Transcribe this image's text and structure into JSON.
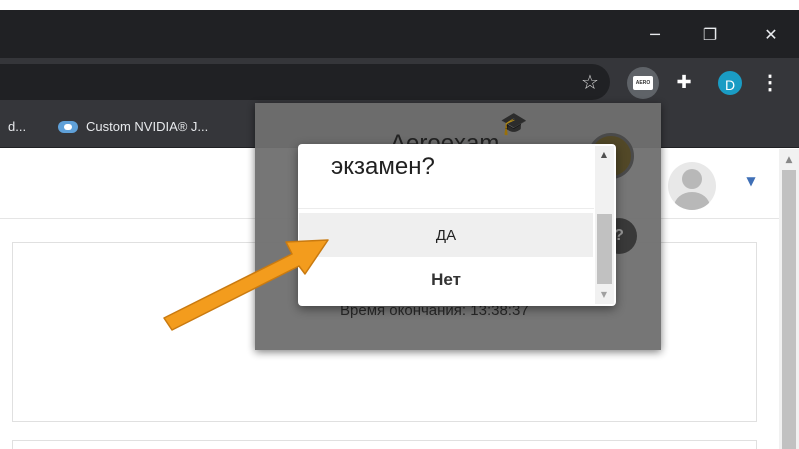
{
  "window": {
    "minimize_glyph": "─",
    "maximize_glyph": "❐",
    "close_glyph": "✕"
  },
  "toolbar": {
    "star_glyph": "☆",
    "aero_ext_label": "AERO",
    "puzzle_glyph": "✚",
    "profile_initial": "D",
    "menu_glyph": "⋮"
  },
  "bookmarks": {
    "items": [
      {
        "label": "d..."
      },
      {
        "label": "Custom NVIDIA® J..."
      }
    ]
  },
  "page": {
    "scroll_up_glyph": "▲",
    "user_caret_glyph": "▼"
  },
  "extension_popup": {
    "title": "Aeroexam",
    "cap_glyph": "🎓",
    "help_glyph": "?",
    "end_time_label": "Время окончания: 13:38:37"
  },
  "dialog": {
    "question": "экзамен?",
    "yes_label": "ДА",
    "no_label": "Нет",
    "scroll_up_glyph": "▲",
    "scroll_down_glyph": "▼"
  },
  "colors": {
    "titlebar": "#202124",
    "toolbar": "#35363a",
    "profile_accent": "#1a9cc4",
    "arrow_fill": "#f39c1d"
  }
}
